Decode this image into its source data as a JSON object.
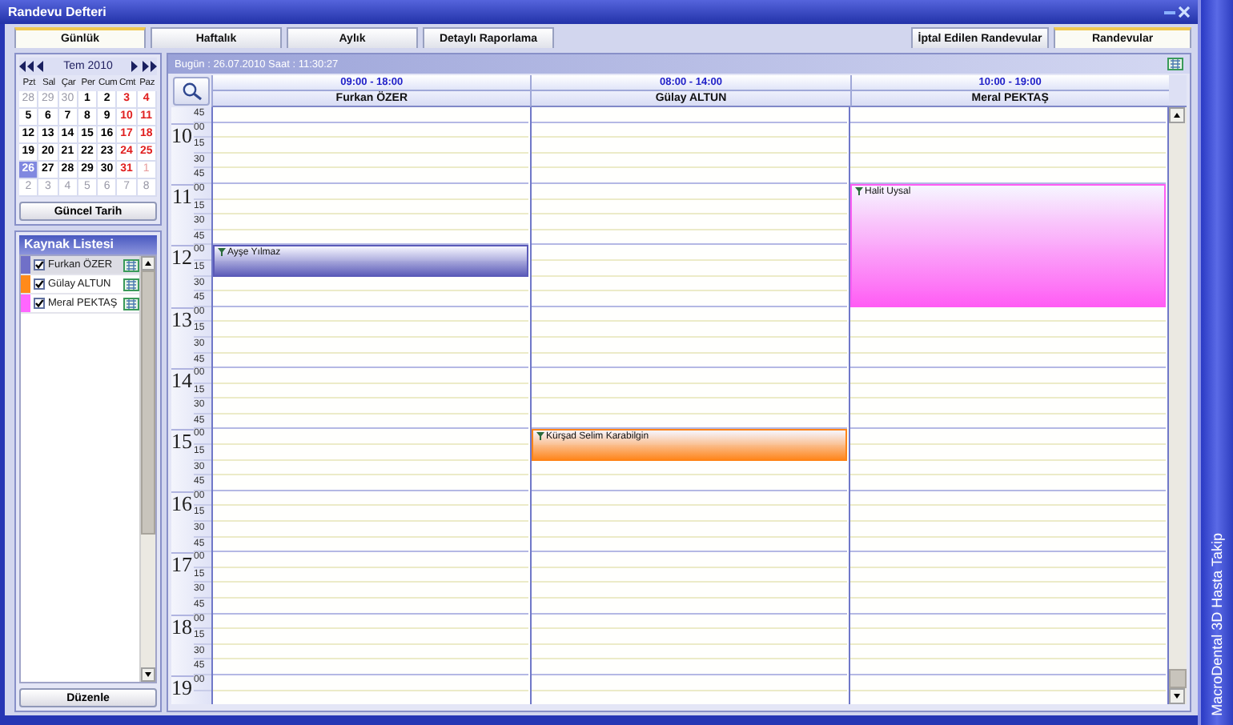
{
  "window": {
    "title": "Randevu Defteri"
  },
  "tabs": [
    {
      "label": "Günlük",
      "selected": true
    },
    {
      "label": "Haftalık",
      "selected": false
    },
    {
      "label": "Aylık",
      "selected": false
    },
    {
      "label": "Detaylı Raporlama",
      "selected": false
    }
  ],
  "right_tabs": [
    {
      "label": "İptal Edilen Randevular",
      "selected": false
    },
    {
      "label": "Randevular",
      "selected": true
    }
  ],
  "side_banner": "MacroDental 3D Hasta Takip",
  "calendar": {
    "month": "Tem 2010",
    "weekdays": [
      "Pzt",
      "Sal",
      "Çar",
      "Per",
      "Cum",
      "Cmt",
      "Paz"
    ],
    "weeks": [
      [
        {
          "day": "28",
          "muted": true,
          "weekend": false,
          "selected": false
        },
        {
          "day": "29",
          "muted": true,
          "weekend": false,
          "selected": false
        },
        {
          "day": "30",
          "muted": true,
          "weekend": false,
          "selected": false
        },
        {
          "day": "1",
          "muted": false,
          "weekend": false,
          "selected": false
        },
        {
          "day": "2",
          "muted": false,
          "weekend": false,
          "selected": false
        },
        {
          "day": "3",
          "muted": false,
          "weekend": true,
          "selected": false
        },
        {
          "day": "4",
          "muted": false,
          "weekend": true,
          "selected": false
        }
      ],
      [
        {
          "day": "5",
          "muted": false,
          "weekend": false,
          "selected": false
        },
        {
          "day": "6",
          "muted": false,
          "weekend": false,
          "selected": false
        },
        {
          "day": "7",
          "muted": false,
          "weekend": false,
          "selected": false
        },
        {
          "day": "8",
          "muted": false,
          "weekend": false,
          "selected": false
        },
        {
          "day": "9",
          "muted": false,
          "weekend": false,
          "selected": false
        },
        {
          "day": "10",
          "muted": false,
          "weekend": true,
          "selected": false
        },
        {
          "day": "11",
          "muted": false,
          "weekend": true,
          "selected": false
        }
      ],
      [
        {
          "day": "12",
          "muted": false,
          "weekend": false,
          "selected": false
        },
        {
          "day": "13",
          "muted": false,
          "weekend": false,
          "selected": false
        },
        {
          "day": "14",
          "muted": false,
          "weekend": false,
          "selected": false
        },
        {
          "day": "15",
          "muted": false,
          "weekend": false,
          "selected": false
        },
        {
          "day": "16",
          "muted": false,
          "weekend": false,
          "selected": false
        },
        {
          "day": "17",
          "muted": false,
          "weekend": true,
          "selected": false
        },
        {
          "day": "18",
          "muted": false,
          "weekend": true,
          "selected": false
        }
      ],
      [
        {
          "day": "19",
          "muted": false,
          "weekend": false,
          "selected": false
        },
        {
          "day": "20",
          "muted": false,
          "weekend": false,
          "selected": false
        },
        {
          "day": "21",
          "muted": false,
          "weekend": false,
          "selected": false
        },
        {
          "day": "22",
          "muted": false,
          "weekend": false,
          "selected": false
        },
        {
          "day": "23",
          "muted": false,
          "weekend": false,
          "selected": false
        },
        {
          "day": "24",
          "muted": false,
          "weekend": true,
          "selected": false
        },
        {
          "day": "25",
          "muted": false,
          "weekend": true,
          "selected": false
        }
      ],
      [
        {
          "day": "26",
          "muted": false,
          "weekend": false,
          "selected": true
        },
        {
          "day": "27",
          "muted": false,
          "weekend": false,
          "selected": false
        },
        {
          "day": "28",
          "muted": false,
          "weekend": false,
          "selected": false
        },
        {
          "day": "29",
          "muted": false,
          "weekend": false,
          "selected": false
        },
        {
          "day": "30",
          "muted": false,
          "weekend": false,
          "selected": false
        },
        {
          "day": "31",
          "muted": false,
          "weekend": true,
          "selected": false
        },
        {
          "day": "1",
          "muted": true,
          "weekend": true,
          "selected": false
        }
      ],
      [
        {
          "day": "2",
          "muted": true,
          "weekend": false,
          "selected": false
        },
        {
          "day": "3",
          "muted": true,
          "weekend": false,
          "selected": false
        },
        {
          "day": "4",
          "muted": true,
          "weekend": false,
          "selected": false
        },
        {
          "day": "5",
          "muted": true,
          "weekend": false,
          "selected": false
        },
        {
          "day": "6",
          "muted": true,
          "weekend": false,
          "selected": false
        },
        {
          "day": "7",
          "muted": true,
          "weekend": false,
          "selected": false
        },
        {
          "day": "8",
          "muted": true,
          "weekend": false,
          "selected": false
        }
      ]
    ]
  },
  "today_button": "Güncel Tarih",
  "resources": {
    "title": "Kaynak Listesi",
    "items": [
      {
        "name": "Furkan ÖZER",
        "color": "#7070c8",
        "checked": true,
        "selected": true
      },
      {
        "name": "Gülay ALTUN",
        "color": "#ff8a1a",
        "checked": true,
        "selected": false
      },
      {
        "name": "Meral PEKTAŞ",
        "color": "#ff66ff",
        "checked": true,
        "selected": false
      }
    ]
  },
  "edit_button": "Düzenle",
  "schedule": {
    "status": "Bugün : 26.07.2010 Saat : 11:30:27",
    "rows": [
      {
        "minute": "45",
        "busy": [
          false,
          false,
          false
        ]
      },
      {
        "hour": "10",
        "minute": "00",
        "busy": [
          false,
          false,
          false
        ]
      },
      {
        "minute": "15",
        "busy": [
          false,
          false,
          false
        ]
      },
      {
        "minute": "30",
        "busy": [
          false,
          false,
          false
        ]
      },
      {
        "minute": "45",
        "busy": [
          false,
          false,
          false
        ]
      },
      {
        "hour": "11",
        "minute": "00",
        "busy": [
          false,
          false,
          true
        ]
      },
      {
        "minute": "15",
        "busy": [
          false,
          false,
          true
        ]
      },
      {
        "minute": "30",
        "busy": [
          false,
          false,
          true
        ]
      },
      {
        "minute": "45",
        "busy": [
          false,
          false,
          true
        ]
      },
      {
        "hour": "12",
        "minute": "00",
        "busy": [
          true,
          false,
          true
        ]
      },
      {
        "minute": "15",
        "busy": [
          true,
          false,
          true
        ]
      },
      {
        "minute": "30",
        "busy": [
          false,
          false,
          true
        ]
      },
      {
        "minute": "45",
        "busy": [
          false,
          false,
          true
        ]
      },
      {
        "hour": "13",
        "minute": "00",
        "busy": [
          false,
          false,
          false
        ]
      },
      {
        "minute": "15",
        "busy": [
          false,
          false,
          false
        ]
      },
      {
        "minute": "30",
        "busy": [
          false,
          false,
          false
        ]
      },
      {
        "minute": "45",
        "busy": [
          false,
          false,
          false
        ]
      },
      {
        "hour": "14",
        "minute": "00",
        "busy": [
          false,
          false,
          false
        ]
      },
      {
        "minute": "15",
        "busy": [
          false,
          false,
          false
        ]
      },
      {
        "minute": "30",
        "busy": [
          false,
          false,
          false
        ]
      },
      {
        "minute": "45",
        "busy": [
          false,
          false,
          false
        ]
      },
      {
        "hour": "15",
        "minute": "00",
        "busy": [
          false,
          true,
          false
        ]
      },
      {
        "minute": "15",
        "busy": [
          false,
          true,
          false
        ]
      },
      {
        "minute": "30",
        "busy": [
          false,
          false,
          false
        ]
      },
      {
        "minute": "45",
        "busy": [
          false,
          false,
          false
        ]
      },
      {
        "hour": "16",
        "minute": "00",
        "busy": [
          false,
          false,
          false
        ]
      },
      {
        "minute": "15",
        "busy": [
          false,
          false,
          false
        ]
      },
      {
        "minute": "30",
        "busy": [
          false,
          false,
          false
        ]
      },
      {
        "minute": "45",
        "busy": [
          false,
          false,
          false
        ]
      },
      {
        "hour": "17",
        "minute": "00",
        "busy": [
          false,
          false,
          false
        ]
      },
      {
        "minute": "15",
        "busy": [
          false,
          false,
          false
        ]
      },
      {
        "minute": "30",
        "busy": [
          false,
          false,
          false
        ]
      },
      {
        "minute": "45",
        "busy": [
          false,
          false,
          false
        ]
      },
      {
        "hour": "18",
        "minute": "00",
        "busy": [
          false,
          false,
          false
        ]
      },
      {
        "minute": "15",
        "busy": [
          false,
          false,
          false
        ]
      },
      {
        "minute": "30",
        "busy": [
          false,
          false,
          false
        ]
      },
      {
        "minute": "45",
        "busy": [
          false,
          false,
          false
        ]
      },
      {
        "hour": "19",
        "minute": "00",
        "busy": [
          false,
          false,
          false
        ]
      }
    ],
    "columns": [
      {
        "hours": "09:00 - 18:00",
        "name": "Furkan ÖZER",
        "appointments": [
          {
            "title": "Ayşe Yılmaz",
            "color": "#5a5ab8"
          }
        ]
      },
      {
        "hours": "08:00 - 14:00",
        "name": "Gülay ALTUN",
        "appointments": [
          {
            "title": "Kürşad Selim Karabilgin",
            "color": "#ff8418"
          }
        ]
      },
      {
        "hours": "10:00 - 19:00",
        "name": "Meral PEKTAŞ",
        "appointments": [
          {
            "title": "Halit Uysal",
            "color": "#ff5cf4"
          }
        ]
      }
    ]
  }
}
